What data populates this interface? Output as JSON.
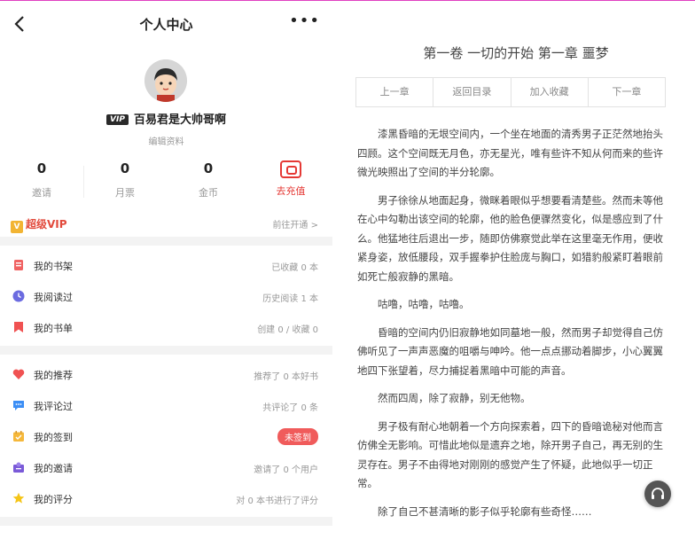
{
  "header": {
    "title": "个人中心",
    "more": "•••"
  },
  "profile": {
    "vip_tag": "VIP",
    "username": "百易君是大帅哥啊",
    "edit_label": "编辑资料"
  },
  "stats": [
    {
      "value": "0",
      "label": "邀请"
    },
    {
      "value": "0",
      "label": "月票"
    },
    {
      "value": "0",
      "label": "金币"
    }
  ],
  "recharge_label": "去充值",
  "vip": {
    "label": "超级VIP",
    "crown": "V",
    "open_label": "前往开通 >"
  },
  "menu_group1": [
    {
      "label": "我的书架",
      "value": "已收藏 0 本",
      "icon": "bookshelf-icon",
      "color": "#f06262"
    },
    {
      "label": "我阅读过",
      "value": "历史阅读 1 本",
      "icon": "clock-icon",
      "color": "#6b6be0"
    },
    {
      "label": "我的书单",
      "value": "创建 0 / 收藏 0",
      "icon": "bookmark-icon",
      "color": "#f05252"
    }
  ],
  "menu_group2": [
    {
      "label": "我的推荐",
      "value": "推荐了 0 本好书",
      "icon": "heart-icon",
      "color": "#f05252"
    },
    {
      "label": "我评论过",
      "value": "共评论了 0 条",
      "icon": "comment-icon",
      "color": "#3b8ef5"
    },
    {
      "label": "我的签到",
      "value": "未签到",
      "icon": "calendar-icon",
      "color": "#f5b83b"
    },
    {
      "label": "我的邀请",
      "value": "邀请了 0 个用户",
      "icon": "invite-icon",
      "color": "#7a5ad8"
    },
    {
      "label": "我的评分",
      "value": "对 0 本书进行了评分",
      "icon": "star-icon",
      "color": "#f5c518"
    }
  ],
  "reader": {
    "chapter_title": "第一卷 一切的开始 第一章 噩梦",
    "nav": [
      "上一章",
      "返回目录",
      "加入收藏",
      "下一章"
    ],
    "paragraphs": [
      "漆黑昏暗的无垠空间内，一个坐在地面的清秀男子正茫然地抬头四顾。这个空间既无月色，亦无星光，唯有些许不知从何而来的些许微光映照出了空间的半分轮廓。",
      "男子徐徐从地面起身，微眯着眼似乎想要看清楚些。然而未等他在心中勾勒出该空间的轮廓，他的脸色便骤然变化，似是感应到了什么。他猛地往后退出一步，随即仿佛察觉此举在这里毫无作用，便收紧身姿，放低腰段，双手握拳护住脸庞与胸口，如猎豹般紧盯着眼前如死亡般寂静的黑暗。",
      "咕噜，咕噜，咕噜。",
      "昏暗的空间内仍旧寂静地如同墓地一般，然而男子却觉得自己仿佛听见了一声声恶魔的咀嚼与呻吟。他一点点挪动着脚步，小心翼翼地四下张望着，尽力捕捉着黑暗中可能的声音。",
      "然而四周，除了寂静，别无他物。",
      "男子极有耐心地朝着一个方向探索着，四下的昏暗诡秘对他而言仿佛全无影响。可惜此地似是遗弃之地，除开男子自己，再无别的生灵存在。男子不由得地对刚刚的感觉产生了怀疑，此地似乎一切正常。",
      "除了自己不甚清晰的影子似乎轮廓有些奇怪……"
    ]
  }
}
